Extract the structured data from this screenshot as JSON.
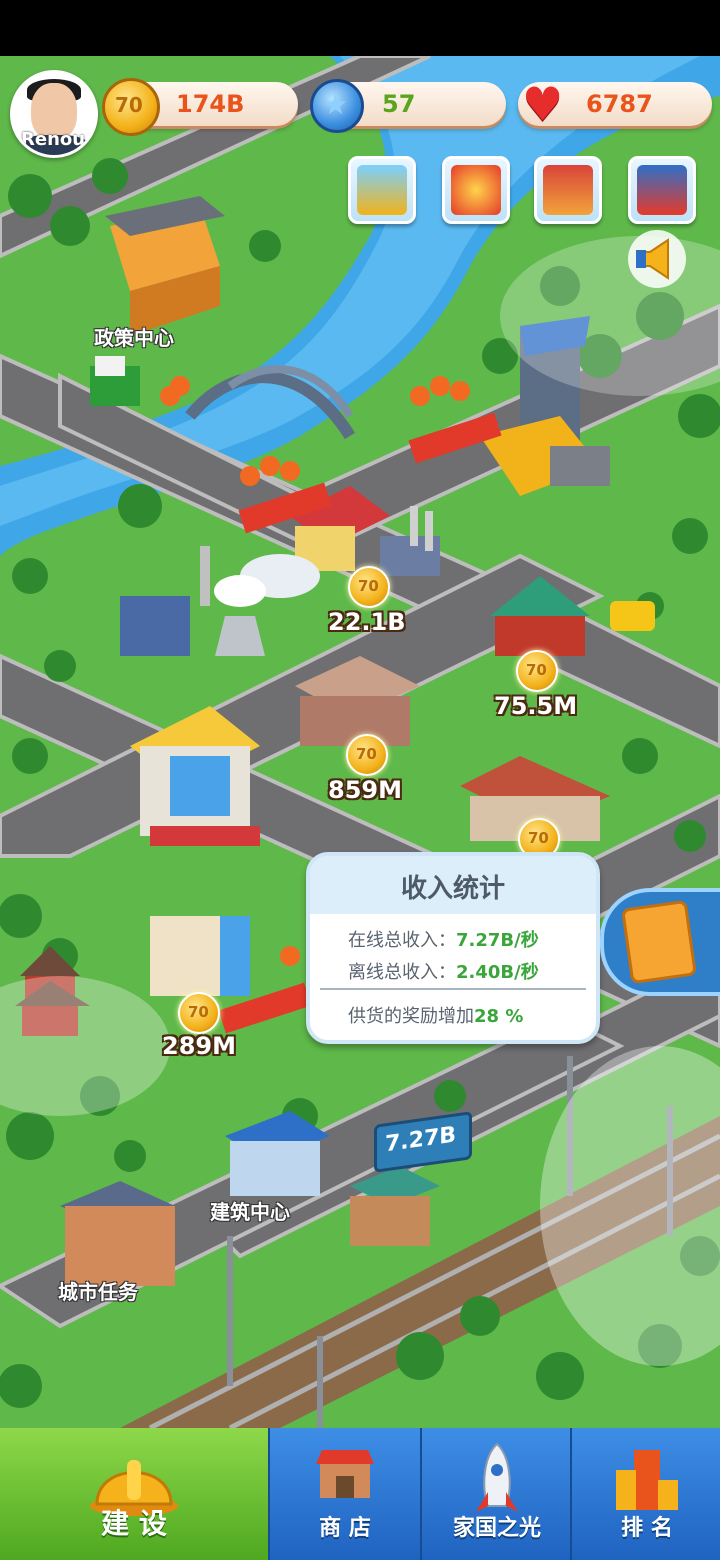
{
  "player": {
    "name": "Renou"
  },
  "resources": [
    {
      "icon": "gold-coin-icon",
      "value": "174B",
      "color": "#e8541c"
    },
    {
      "icon": "blue-star-icon",
      "value": "57",
      "color": "#5aa51e"
    },
    {
      "icon": "heart-icon",
      "value": "6787",
      "color": "#e8541c"
    }
  ],
  "features": [
    {
      "icon": "factory-icon"
    },
    {
      "icon": "anniversary-70-icon"
    },
    {
      "icon": "handshake-icon"
    },
    {
      "icon": "mascot-icon"
    }
  ],
  "buildings": {
    "policy_center": "政策中心",
    "building_center": "建筑中心",
    "city_tasks": "城市任务"
  },
  "incomes": [
    "22.1B",
    "75.5M",
    "859M",
    "289M"
  ],
  "coin_text": "70",
  "billboard": "7.27B",
  "income_panel": {
    "title": "收入统计",
    "online_label": "在线总收入：",
    "online_value": "7.27B/秒",
    "offline_label": "离线总收入：",
    "offline_value": "2.40B/秒",
    "bonus_label": "供货的奖励增加",
    "bonus_value": "28 %"
  },
  "nav": {
    "build": "建 设",
    "shop": "商 店",
    "homeland": "家国之光",
    "rank": "排 名"
  }
}
